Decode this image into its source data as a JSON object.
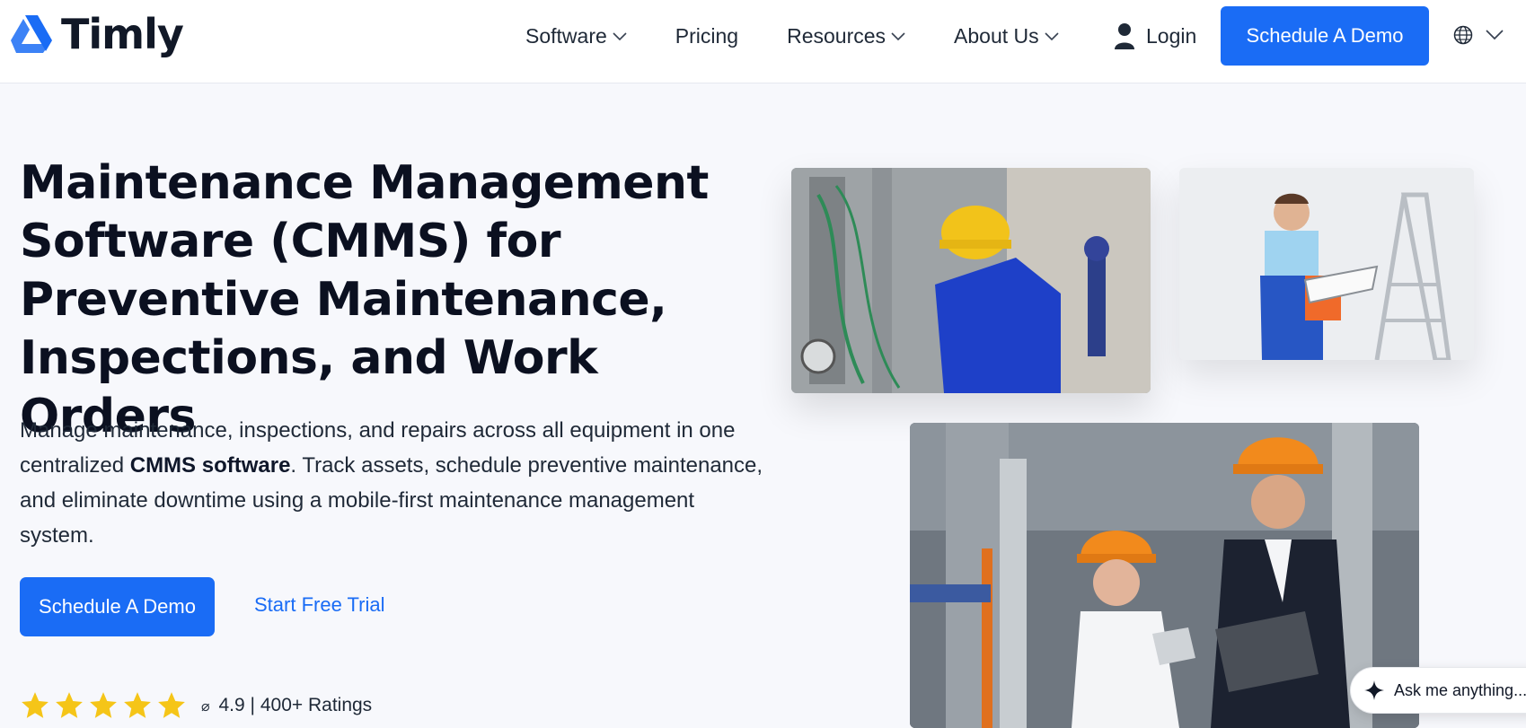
{
  "brand": {
    "name": "Timly",
    "accent_color": "#1a6cf5"
  },
  "nav": {
    "items": [
      {
        "label": "Software",
        "has_dropdown": true
      },
      {
        "label": "Pricing",
        "has_dropdown": false
      },
      {
        "label": "Resources",
        "has_dropdown": true
      },
      {
        "label": "About Us",
        "has_dropdown": true
      }
    ],
    "login_label": "Login",
    "demo_label": "Schedule A Demo",
    "language_icon": "globe-icon"
  },
  "hero": {
    "title": "Maintenance Management Software (CMMS) for Preventive Maintenance, Inspections, and Work Orders",
    "desc_before": "Manage maintenance, inspections, and repairs across all equipment in one centralized ",
    "desc_bold": "CMMS software",
    "desc_after": ". Track assets, schedule preventive maintenance, and eliminate downtime using a mobile-first maintenance management system.",
    "cta_primary": "Schedule A Demo",
    "cta_secondary": "Start Free Trial",
    "rating": {
      "stars": 5,
      "avg_symbol": "⌀",
      "score": "4.9",
      "separator": "|",
      "count": "400+ Ratings"
    }
  },
  "images": {
    "photo1": "worker-hardhat-pipes-photo",
    "photo2": "worker-clipboard-ladder-photo",
    "photo3": "engineers-laptop-factory-photo"
  },
  "chat": {
    "placeholder": "Ask me anything..."
  }
}
